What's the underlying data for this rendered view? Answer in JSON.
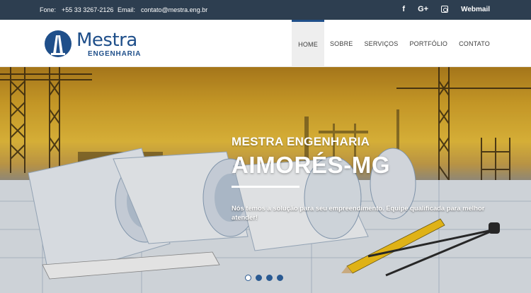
{
  "topbar": {
    "phone_label": "Fone:",
    "phone_value": "+55 33 3267-2126",
    "email_label": "Email:",
    "email_value": "contato@mestra.eng.br",
    "social": [
      "facebook-icon",
      "google-plus-icon",
      "instagram-icon"
    ],
    "facebook_glyph": "f",
    "gplus_glyph": "G+",
    "webmail_label": "Webmail"
  },
  "header": {
    "logo_name": "Mestra",
    "logo_sub": "ENGENHARIA",
    "nav": [
      {
        "label": "HOME",
        "active": true
      },
      {
        "label": "SOBRE",
        "active": false
      },
      {
        "label": "SERVIÇOS",
        "active": false
      },
      {
        "label": "PORTFÓLIO",
        "active": false
      },
      {
        "label": "CONTATO",
        "active": false
      }
    ]
  },
  "hero": {
    "kicker": "MESTRA ENGENHARIA",
    "title": "AIMORÉS-MG",
    "description": "Nós temos a solução para seu empreendimento. Equipe qualificada para melhor atender!",
    "slides": 4,
    "active_slide": 1
  },
  "colors": {
    "topbar_bg": "#2d3e50",
    "brand_blue": "#1f4f8a",
    "nav_active_bg": "#eeeeee"
  }
}
